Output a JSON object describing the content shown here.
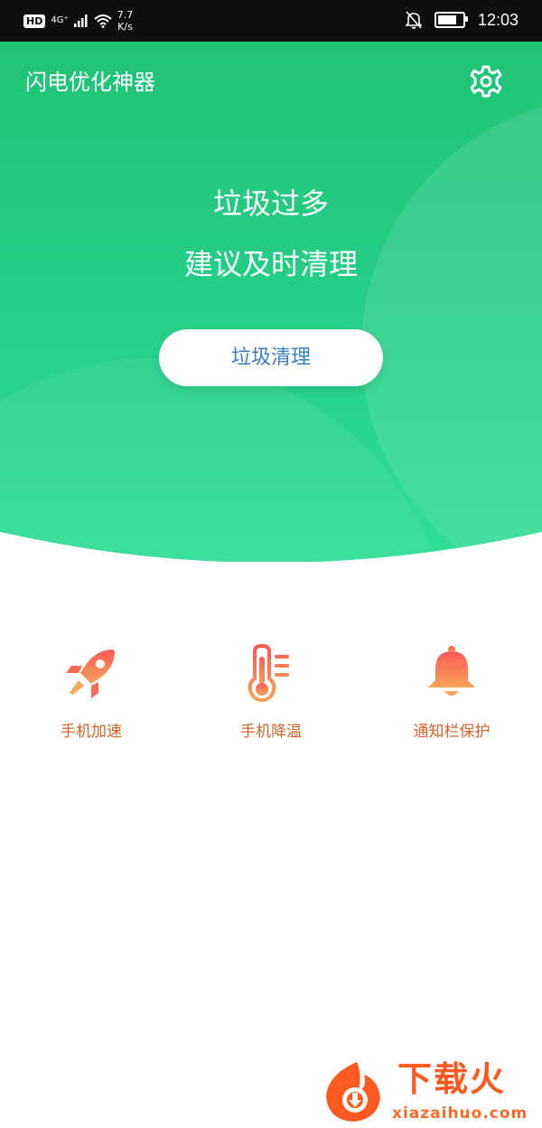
{
  "status_bar": {
    "hd": "HD",
    "network": "4G⁺",
    "speed_value": "7.7",
    "speed_unit": "K/s",
    "time": "12:03"
  },
  "header": {
    "app_title": "闪电优化神器",
    "settings_icon": "gear-icon"
  },
  "hero": {
    "line1": "垃圾过多",
    "line2": "建议及时清理",
    "button_label": "垃圾清理"
  },
  "features": [
    {
      "label": "手机加速",
      "icon": "rocket-icon"
    },
    {
      "label": "手机降温",
      "icon": "thermometer-icon"
    },
    {
      "label": "通知栏保护",
      "icon": "bell-icon"
    }
  ],
  "watermark": {
    "title": "下载火",
    "site": "xiazaihuo.com"
  },
  "colors": {
    "accent_green": "#27d18a",
    "feature_orange": "#d4642a",
    "button_text_blue": "#3a7fb8"
  }
}
